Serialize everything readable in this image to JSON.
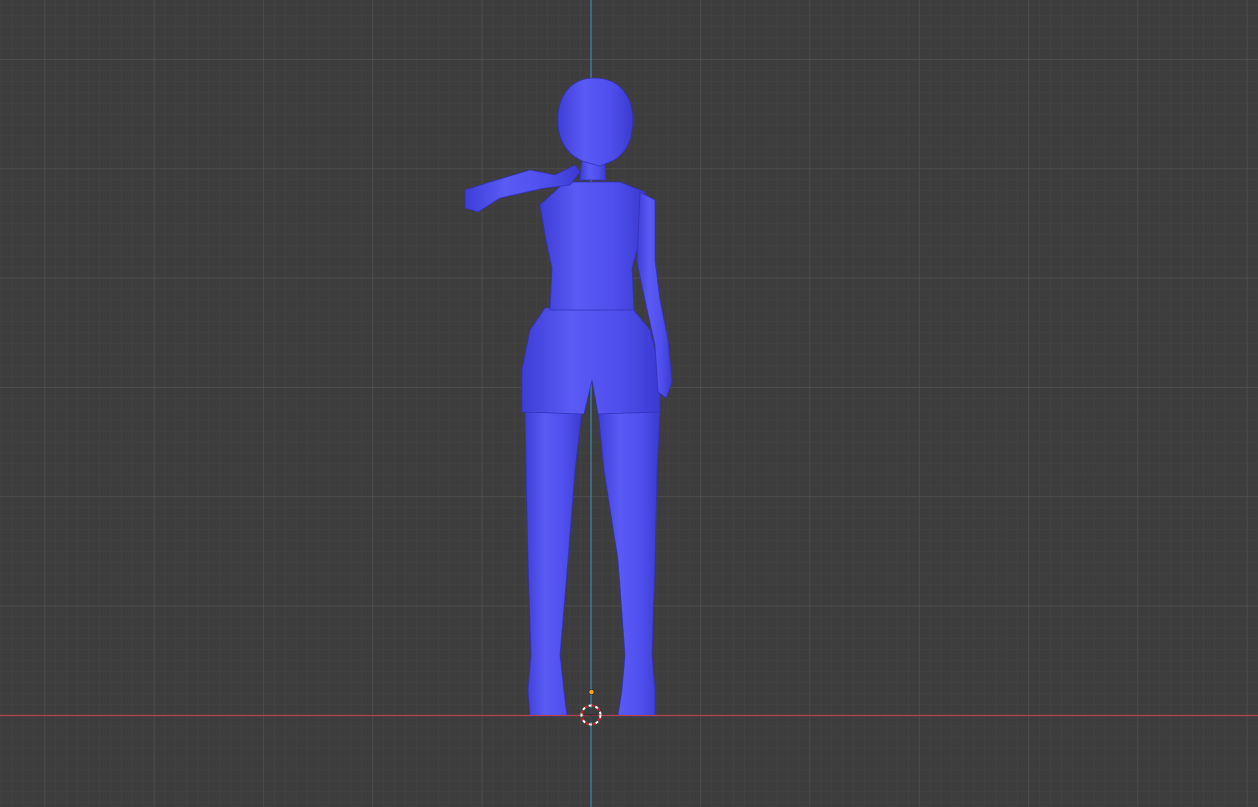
{
  "viewport": {
    "background": "#3d3d3d",
    "grid_minor_color": "#444444",
    "grid_major_color": "#4f4f4f",
    "x_axis_color": "#b5414d",
    "z_axis_color": "#3f7fa8",
    "model_color": "#4f4ff0",
    "icons": {
      "cursor": "3d-cursor-icon",
      "origin": "object-origin-icon"
    }
  }
}
